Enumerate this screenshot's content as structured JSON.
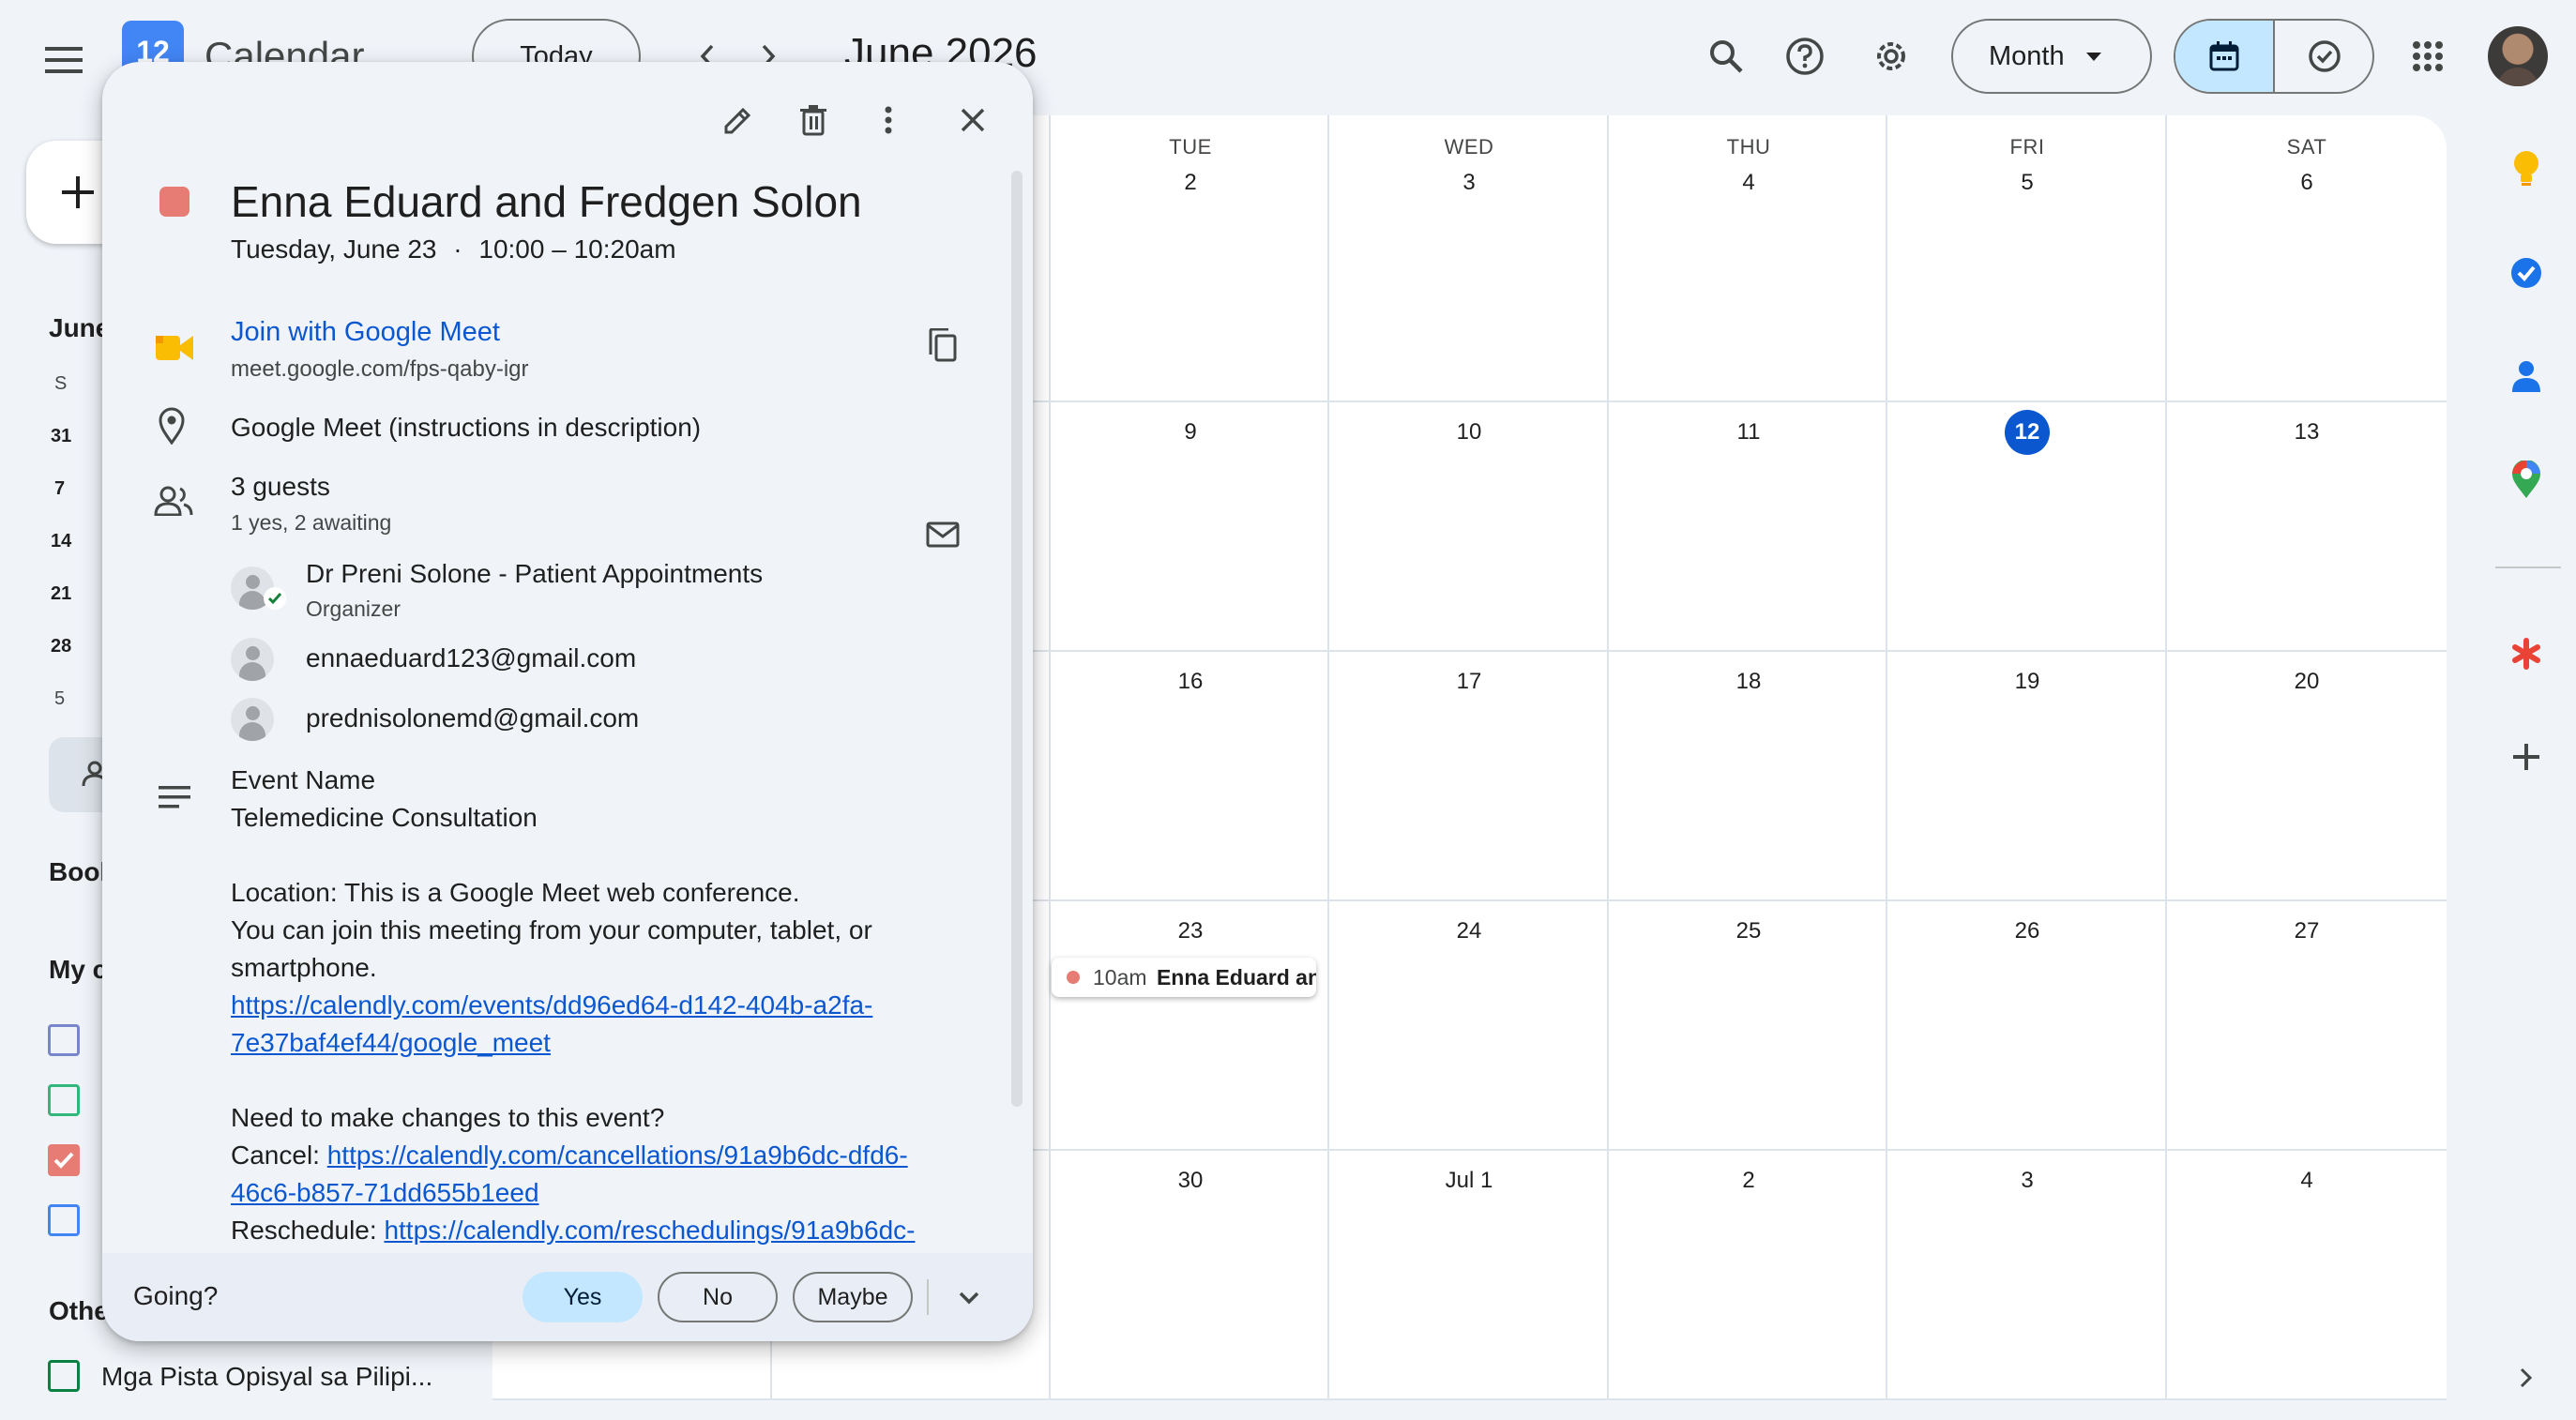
{
  "header": {
    "app_name": "Calendar",
    "logo_day": "12",
    "today_label": "Today",
    "month_title": "June 2026",
    "view_label": "Month"
  },
  "grid": {
    "day_headers": [
      "TUE",
      "WED",
      "THU",
      "FRI",
      "SAT"
    ],
    "weeks": [
      [
        "2",
        "3",
        "4",
        "5",
        "6"
      ],
      [
        "9",
        "10",
        "11",
        "12",
        "13"
      ],
      [
        "16",
        "17",
        "18",
        "19",
        "20"
      ],
      [
        "23",
        "24",
        "25",
        "26",
        "27"
      ],
      [
        "30",
        "Jul 1",
        "2",
        "3",
        "4"
      ]
    ],
    "today": "12",
    "event_chip": {
      "time": "10am",
      "title": "Enna Eduard an"
    }
  },
  "sidebar": {
    "mini_month": "June",
    "mini_day_header": "S",
    "mini_days": [
      "31",
      "7",
      "14",
      "21",
      "28",
      "5"
    ],
    "booking_label": "Bool",
    "my_calendars_label": "My c",
    "other_calendars_label": "Othe",
    "other_calendar_item": "Mga Pista Opisyal sa Pilipi...",
    "calendar_colors": [
      "#7986cb",
      "#33b679",
      "#e67c73",
      "#4285f4"
    ]
  },
  "event": {
    "title": "Enna Eduard and Fredgen Solon",
    "color": "#e67c73",
    "date": "Tuesday, June 23",
    "separator": "·",
    "time": "10:00 – 10:20am",
    "meet_label": "Join with Google Meet",
    "meet_url": "meet.google.com/fps-qaby-igr",
    "location": "Google Meet (instructions in description)",
    "guests_count": "3 guests",
    "guests_status": "1 yes, 2 awaiting",
    "guests": [
      {
        "name": "Dr Preni Solone - Patient Appointments",
        "role": "Organizer"
      },
      {
        "name": "ennaeduard123@gmail.com"
      },
      {
        "name": "prednisolonemd@gmail.com"
      }
    ],
    "description": {
      "label": "Event Name",
      "name": "Telemedicine Consultation",
      "location_line": "Location: This is a Google Meet web conference.",
      "join_line1": "You can join this meeting from your computer, tablet, or",
      "join_line2": "smartphone.",
      "link1_a": "https://calendly.com/events/dd96ed64-d142-404b-a2fa-",
      "link1_b": "7e37baf4ef44/google_meet",
      "changes": "Need to make changes to this event?",
      "cancel_label": "Cancel: ",
      "cancel_link_a": "https://calendly.com/cancellations/91a9b6dc-dfd6-",
      "cancel_link_b": "46c6-b857-71dd655b1eed",
      "reschedule_label": "Reschedule: ",
      "reschedule_link": "https://calendly.com/reschedulings/91a9b6dc-"
    },
    "rsvp": {
      "going_label": "Going?",
      "yes": "Yes",
      "no": "No",
      "maybe": "Maybe"
    }
  }
}
